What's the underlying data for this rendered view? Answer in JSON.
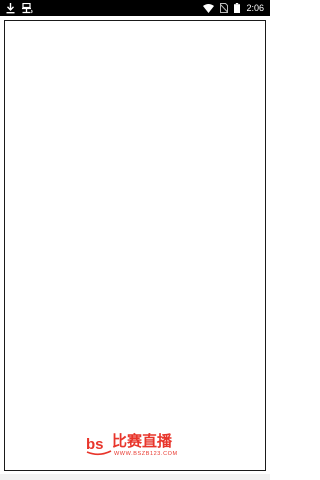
{
  "status_bar": {
    "time": "2:06",
    "left_icons": [
      "download-icon",
      "bug-icon"
    ],
    "right_icons": [
      "wifi-icon",
      "no-sim-icon",
      "battery-icon"
    ]
  },
  "splash": {
    "logo_text": "比赛直播",
    "logo_url": "WWW.BSZB123.COM",
    "logo_mark": "bs",
    "brand_color": "#e8352b"
  }
}
